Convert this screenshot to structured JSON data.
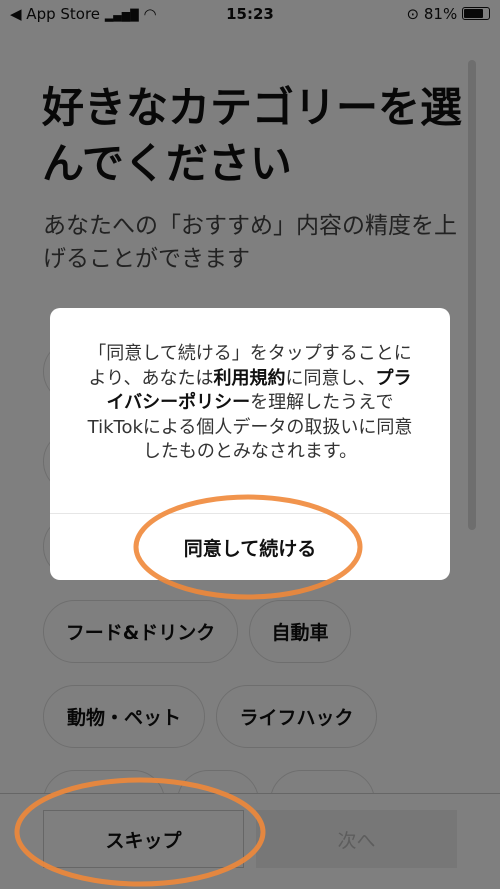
{
  "status_bar": {
    "back_app": "◀ App Store",
    "signal": "▂▄▆█",
    "wifi": "◠",
    "time": "15:23",
    "orientation_lock": "⊙",
    "battery": "81%"
  },
  "header": {
    "title": "好きなカテゴリーを選んでください",
    "subtitle": "あなたへの「おすすめ」内容の精度を上げることができます"
  },
  "categories": [
    {
      "label": "フード&ドリンク"
    },
    {
      "label": "自動車"
    },
    {
      "label": "動物・ペット"
    },
    {
      "label": "ライフハック"
    }
  ],
  "footer": {
    "skip": "スキップ",
    "next": "次へ"
  },
  "dialog": {
    "msg_1": "「同意して続ける」をタップすることにより、あなたは",
    "terms": "利用規約",
    "msg_2": "に同意し、",
    "privacy": "プライバシーポリシー",
    "msg_3": "を理解したうえでTikTokによる個人データの取扱いに同意したものとみなされます。",
    "agree": "同意して続ける"
  },
  "annotation_color": "#f0883a"
}
